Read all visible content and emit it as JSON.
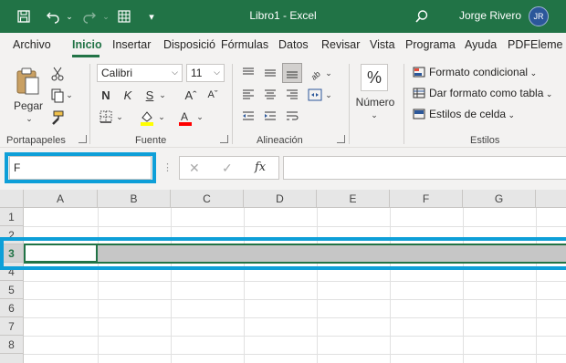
{
  "titlebar": {
    "title": "Libro1  -  Excel",
    "user": "Jorge Rivero",
    "initials": "JR",
    "icons": [
      "save-icon",
      "undo-icon",
      "redo-icon",
      "table-icon",
      "customize-qat-icon",
      "search-icon"
    ]
  },
  "tabs": [
    "Archivo",
    "Inicio",
    "Insertar",
    "Disposició",
    "Fórmulas",
    "Datos",
    "Revisar",
    "Vista",
    "Programa",
    "Ayuda",
    "PDFEleme"
  ],
  "active_tab": "Inicio",
  "ribbon": {
    "clipboard": {
      "paste_label": "Pegar",
      "group_label": "Portapapeles"
    },
    "font": {
      "font_name": "Calibri",
      "font_size": "11",
      "bold": "N",
      "italic": "K",
      "underline": "S",
      "grow": "Aˆ",
      "shrink": "Aˇ",
      "group_label": "Fuente",
      "fill_color": "#ffff00",
      "font_color": "#ff0000"
    },
    "alignment": {
      "group_label": "Alineación"
    },
    "number": {
      "symbol": "%",
      "label": "Número"
    },
    "styles": {
      "conditional": "Formato condicional",
      "format_table": "Dar formato como tabla",
      "cell_styles": "Estilos de celda",
      "group_label": "Estilos"
    }
  },
  "formula_bar": {
    "name_box_value": "F",
    "fx": "fx",
    "cancel": "✕",
    "enter": "✓",
    "formula_value": ""
  },
  "grid": {
    "columns": [
      "A",
      "B",
      "C",
      "D",
      "E",
      "F",
      "G"
    ],
    "rows": [
      "1",
      "2",
      "3",
      "4",
      "5",
      "6",
      "7",
      "8"
    ],
    "selected_row": "3"
  },
  "colors": {
    "excel_green": "#217346",
    "highlight_blue": "#0e9fd8",
    "avatar": "#2b579a"
  }
}
